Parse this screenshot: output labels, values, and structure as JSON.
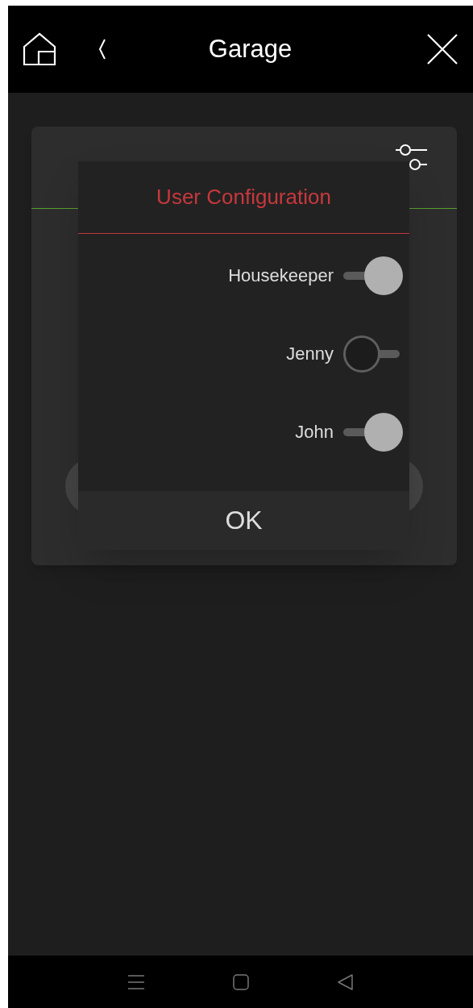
{
  "header": {
    "title": "Garage"
  },
  "dialog": {
    "title": "User Configuration",
    "users": [
      {
        "name": "Housekeeper",
        "on": true
      },
      {
        "name": "Jenny",
        "on": false
      },
      {
        "name": "John",
        "on": true
      }
    ],
    "button": "OK"
  }
}
